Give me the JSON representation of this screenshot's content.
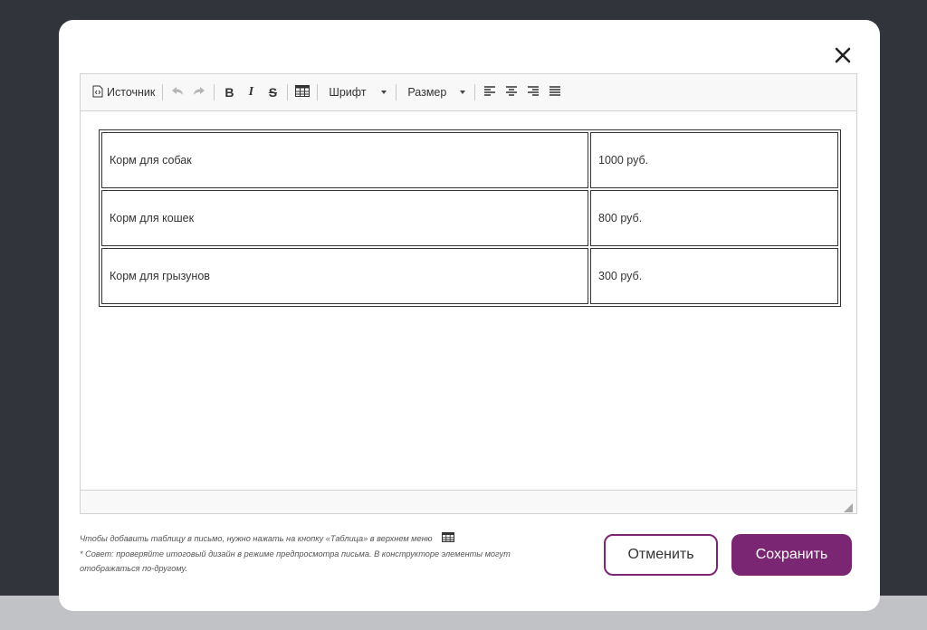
{
  "colors": {
    "accent": "#7b2673",
    "backdrop": "#32343b"
  },
  "dialog": {
    "close_icon": "close-icon"
  },
  "toolbar": {
    "source_label": "Источник",
    "source_icon": "source-icon",
    "undo_icon": "undo-icon",
    "redo_icon": "redo-icon",
    "bold_label": "B",
    "italic_label": "I",
    "strike_label": "S",
    "table_icon": "table-icon",
    "font_label": "Шрифт",
    "size_label": "Размер",
    "align_icons": [
      "align-left-icon",
      "align-center-icon",
      "align-right-icon",
      "align-justify-icon"
    ]
  },
  "table": {
    "rows": [
      {
        "name": "Корм для собак",
        "price": "1000 руб."
      },
      {
        "name": "Корм для кошек",
        "price": "800 руб."
      },
      {
        "name": "Корм для грызунов",
        "price": "300 руб."
      }
    ]
  },
  "notes": {
    "line1": "Чтобы добавить таблицу в письмо, нужно нажать на кнопку «Таблица» в верхнем меню",
    "line2": "* Совет: проверяйте итоговый дизайн в режиме предпросмотра письма. В конструкторе элементы могут отображаться по-другому."
  },
  "buttons": {
    "cancel": "Отменить",
    "save": "Сохранить"
  }
}
